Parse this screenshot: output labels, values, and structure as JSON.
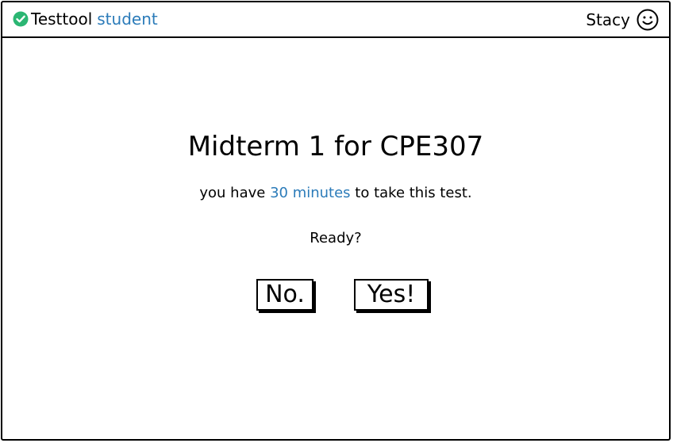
{
  "header": {
    "app_name": "Testtool",
    "role": "student",
    "user_name": "Stacy",
    "icons": {
      "status": "check-circle-icon",
      "user": "smiley-icon"
    }
  },
  "main": {
    "title": "Midterm 1 for CPE307",
    "info_prefix": "you have ",
    "info_duration": "30 minutes",
    "info_suffix": " to take this test.",
    "prompt": "Ready?",
    "buttons": {
      "no_label": "No.",
      "yes_label": "Yes!"
    }
  },
  "colors": {
    "accent": "#2b7bb9",
    "success": "#2bb673",
    "text": "#000000",
    "background": "#ffffff"
  }
}
